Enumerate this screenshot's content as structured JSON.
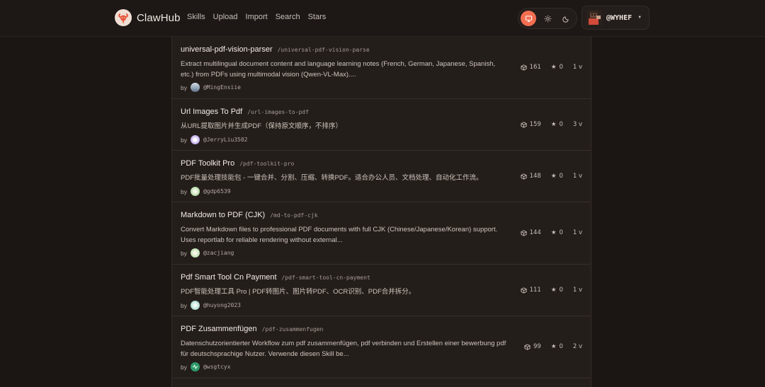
{
  "brand": {
    "name": "ClawHub",
    "accent": "#f26e51"
  },
  "nav": {
    "items": [
      {
        "label": "Skills"
      },
      {
        "label": "Upload"
      },
      {
        "label": "Import"
      },
      {
        "label": "Search"
      },
      {
        "label": "Stars"
      }
    ]
  },
  "theme": {
    "options": [
      {
        "icon": "monitor-icon",
        "active": true
      },
      {
        "icon": "sun-icon",
        "active": false
      },
      {
        "icon": "moon-icon",
        "active": false
      }
    ]
  },
  "user": {
    "handle": "@WYHEF",
    "caret_icon": "caret-down-icon"
  },
  "skills": [
    {
      "name": "universal-pdf-vision-parser",
      "slug": "/universal-pdf-vision-parse",
      "description": "Extract multilingual document content and language learning notes (French, German, Japanese, Spanish, etc.) from PDFs using multimodal vision (Qwen-VL-Max)....",
      "by": "by",
      "author": "@MingEnsiie",
      "downloads": "161",
      "stars": "0",
      "versions": "1 v",
      "avatar_color": "#8fa1b5"
    },
    {
      "name": "Url Images To Pdf",
      "slug": "/url-images-to-pdf",
      "description": "从URL提取图片并生成PDF（保持原文顺序，不排序）",
      "by": "by",
      "author": "@JerryLiu3502",
      "downloads": "159",
      "stars": "0",
      "versions": "3 v",
      "avatar_color": "#b7a0e6"
    },
    {
      "name": "PDF Toolkit Pro",
      "slug": "/pdf-toolkit-pro",
      "description": "PDF批量处理技能包 - 一键合并、分割、压缩、转换PDF。适合办公人员、文档处理、自动化工作流。",
      "by": "by",
      "author": "@gdp6539",
      "downloads": "148",
      "stars": "0",
      "versions": "1 v",
      "avatar_color": "#a6d49a"
    },
    {
      "name": "Markdown to PDF (CJK)",
      "slug": "/md-to-pdf-cjk",
      "description": "Convert Markdown files to professional PDF documents with full CJK (Chinese/Japanese/Korean) support. Uses reportlab for reliable rendering without external...",
      "by": "by",
      "author": "@zacjiang",
      "downloads": "144",
      "stars": "0",
      "versions": "1 v",
      "avatar_color": "#b5d8a8"
    },
    {
      "name": "Pdf Smart Tool Cn Payment",
      "slug": "/pdf-smart-tool-cn-payment",
      "description": "PDF智能处理工具 Pro | PDF转图片、图片转PDF、OCR识别、PDF合并拆分。",
      "by": "by",
      "author": "@huyong2023",
      "downloads": "111",
      "stars": "0",
      "versions": "1 v",
      "avatar_color": "#9fd6c8"
    },
    {
      "name": "PDF Zusammenfügen",
      "slug": "/pdf-zusammenfugen",
      "description": "Datenschutzorientierter Workflow zum pdf zusammenfügen, pdf verbinden und Erstellen einer bewerbung pdf für deutschsprachige Nutzer. Verwende diesen Skill be...",
      "by": "by",
      "author": "@wsgtcyx",
      "downloads": "99",
      "stars": "0",
      "versions": "2 v",
      "avatar_color": "#2f9a6a"
    }
  ]
}
